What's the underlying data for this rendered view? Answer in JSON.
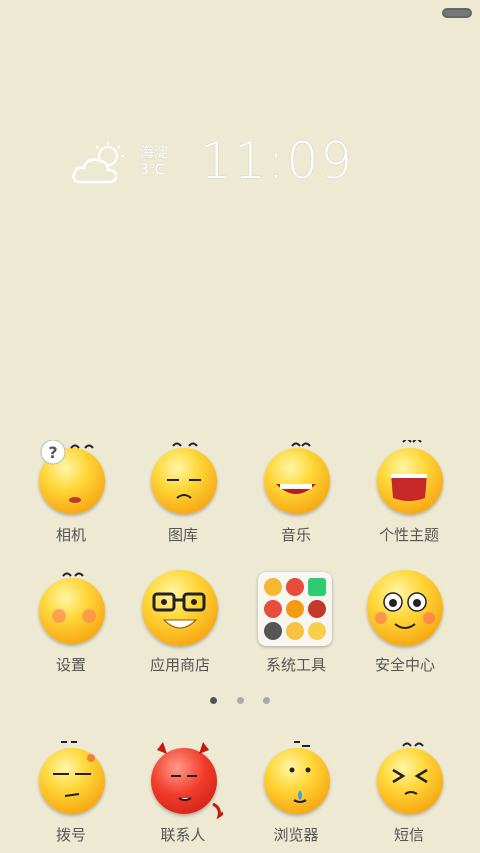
{
  "status": {
    "battery_icon": "battery-icon"
  },
  "weather": {
    "location": "海淀",
    "temperature": "3℃",
    "time": "11:09",
    "icon": "cloud-sun-icon"
  },
  "apps": [
    {
      "label": "相机"
    },
    {
      "label": "图库"
    },
    {
      "label": "音乐"
    },
    {
      "label": "个性主题"
    },
    {
      "label": "设置"
    },
    {
      "label": "应用商店"
    },
    {
      "label": "系统工具"
    },
    {
      "label": "安全中心"
    }
  ],
  "pages": {
    "count": 3,
    "active": 0
  },
  "dock": [
    {
      "label": "拨号"
    },
    {
      "label": "联系人"
    },
    {
      "label": "浏览器"
    },
    {
      "label": "短信"
    }
  ],
  "colors": {
    "background": "#ede9d3",
    "face_yellow": "#ffd83a",
    "face_red": "#f23b2a"
  }
}
